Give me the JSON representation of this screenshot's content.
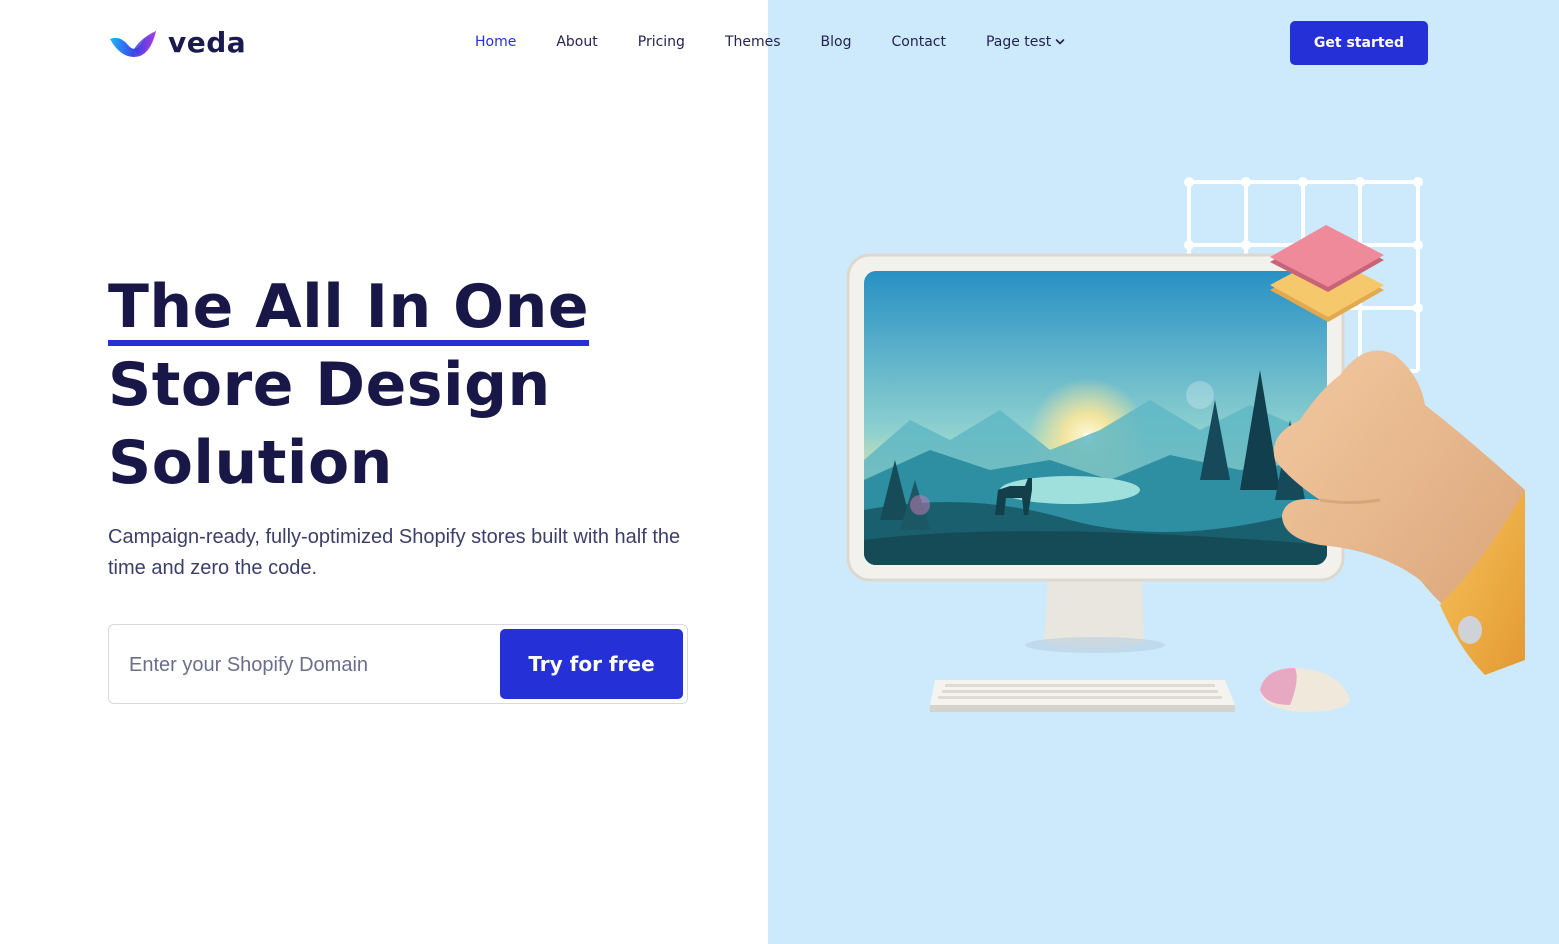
{
  "brand": {
    "name": "veda"
  },
  "nav": {
    "items": [
      {
        "label": "Home",
        "active": true
      },
      {
        "label": "About",
        "active": false
      },
      {
        "label": "Pricing",
        "active": false
      },
      {
        "label": "Themes",
        "active": false
      },
      {
        "label": "Blog",
        "active": false
      },
      {
        "label": "Contact",
        "active": false
      },
      {
        "label": "Page test",
        "active": false,
        "icon": "chevron-down-icon"
      }
    ],
    "cta_label": "Get started"
  },
  "hero": {
    "title_line1": "The All In One",
    "title_line2": "Store Design",
    "title_line3": "Solution",
    "subtitle": "Campaign-ready, fully-optimized Shopify stores built with half the time and zero the code.",
    "input_placeholder": "Enter your Shopify Domain",
    "input_value": "",
    "button_label": "Try for free"
  },
  "colors": {
    "accent": "#2530d6",
    "heading": "#181747",
    "right_panel_bg": "#cdeafd"
  }
}
